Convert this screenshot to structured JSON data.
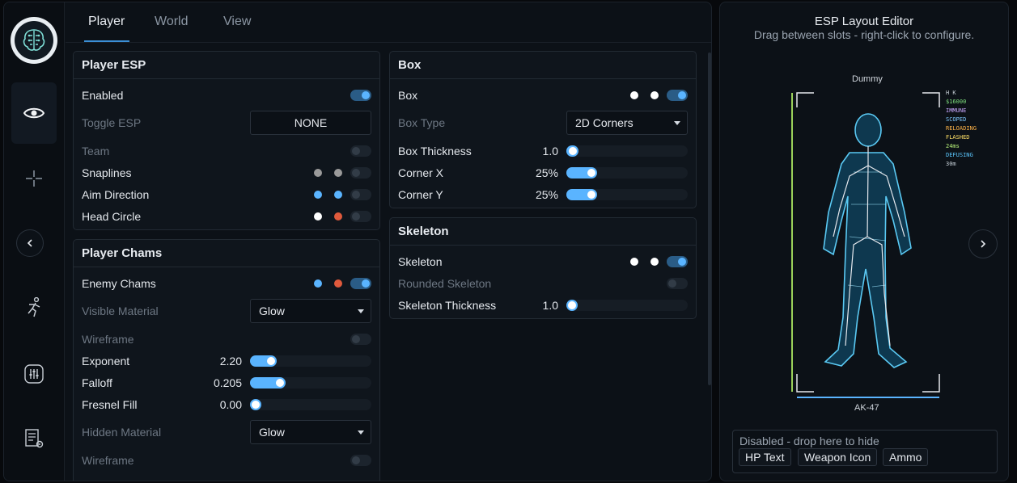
{
  "tabs": [
    "Player",
    "World",
    "View"
  ],
  "player_esp": {
    "title": "Player ESP",
    "enabled": "Enabled",
    "toggle_esp": "Toggle ESP",
    "toggle_value": "NONE",
    "team": "Team",
    "snaplines": "Snaplines",
    "aim_direction": "Aim Direction",
    "head_circle": "Head Circle"
  },
  "player_chams": {
    "title": "Player Chams",
    "enemy_chams": "Enemy Chams",
    "visible_material": "Visible Material",
    "visible_material_value": "Glow",
    "wireframe": "Wireframe",
    "exponent": "Exponent",
    "exponent_value": "2.20",
    "exponent_fill": 0.22,
    "falloff": "Falloff",
    "falloff_value": "0.205",
    "falloff_fill": 0.29,
    "fresnel_fill": "Fresnel Fill",
    "fresnel_value": "0.00",
    "fresnel_fill_level": 0.0,
    "hidden_material": "Hidden Material",
    "hidden_material_value": "Glow",
    "wireframe2": "Wireframe"
  },
  "box": {
    "title": "Box",
    "box": "Box",
    "box_type": "Box Type",
    "box_type_value": "2D Corners",
    "box_thickness": "Box Thickness",
    "box_thickness_value": "1.0",
    "box_thickness_fill": 0.1,
    "corner_x": "Corner X",
    "corner_x_value": "25%",
    "corner_x_fill": 0.25,
    "corner_y": "Corner Y",
    "corner_y_value": "25%",
    "corner_y_fill": 0.25
  },
  "skeleton": {
    "title": "Skeleton",
    "skeleton": "Skeleton",
    "rounded_skeleton": "Rounded Skeleton",
    "thickness": "Skeleton Thickness",
    "thickness_value": "1.0",
    "thickness_fill": 0.0
  },
  "editor": {
    "title": "ESP Layout Editor",
    "subtitle": "Drag between slots - right-click to configure.",
    "player_name": "Dummy",
    "weapon": "AK-47",
    "flags": [
      {
        "text": "H K",
        "color": "#c9d2da"
      },
      {
        "text": "$16000",
        "color": "#7fe07f"
      },
      {
        "text": "IMMUNE",
        "color": "#c9a8ff"
      },
      {
        "text": "SCOPED",
        "color": "#7ec8ff"
      },
      {
        "text": "RELOADING",
        "color": "#ffb347"
      },
      {
        "text": "FLASHED",
        "color": "#ffe066"
      },
      {
        "text": "24ms",
        "color": "#b9f57a"
      },
      {
        "text": "DEFUSING",
        "color": "#5cc8ff"
      },
      {
        "text": "30m",
        "color": "#c9d2da"
      }
    ],
    "disabled_zone": "Disabled - drop here to hide",
    "chips": [
      "HP Text",
      "Weapon Icon",
      "Ammo"
    ]
  },
  "colors": {
    "accent": "#5ab4ff",
    "red": "#e05a3c",
    "grey": "#9a9a9a"
  },
  "icons": [
    "logo-brain-icon",
    "eye-icon",
    "crosshair-icon",
    "collapse-left-icon",
    "running-person-icon",
    "sliders-icon",
    "script-gear-icon",
    "chevron-right-icon"
  ]
}
